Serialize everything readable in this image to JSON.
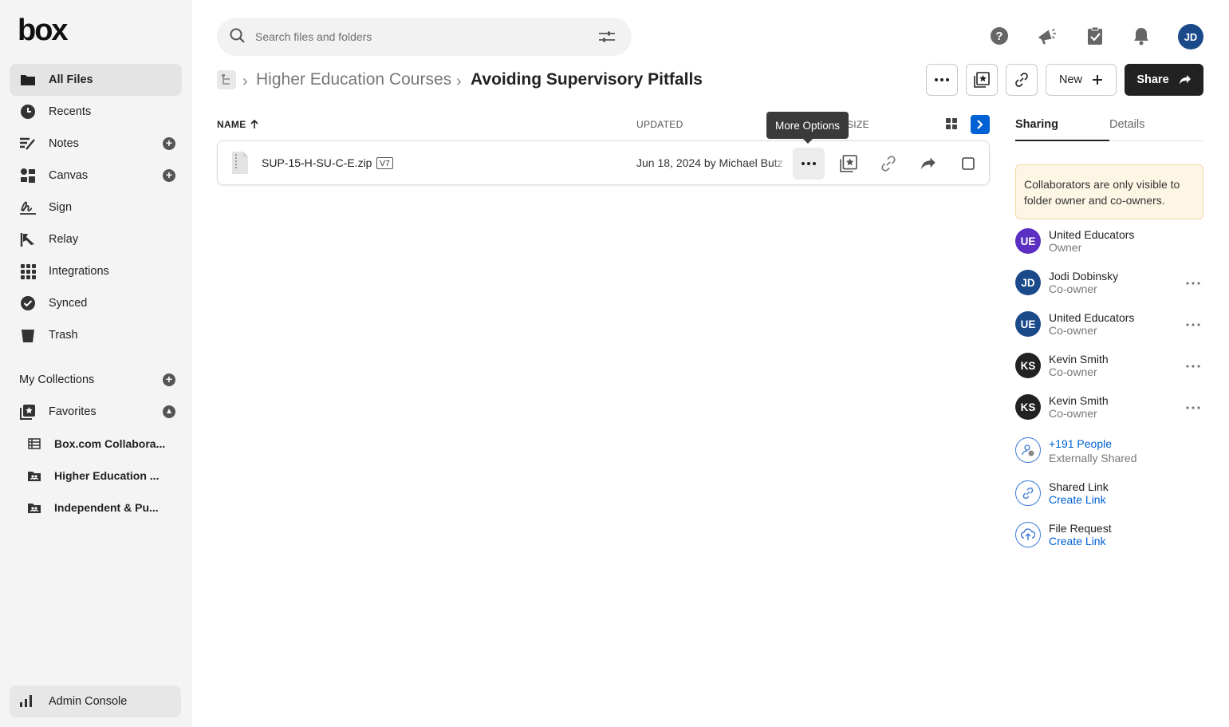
{
  "app": {
    "logo_text": "box"
  },
  "sidebar": {
    "items": [
      {
        "label": "All Files",
        "icon": "folder-icon"
      },
      {
        "label": "Recents",
        "icon": "clock-icon"
      },
      {
        "label": "Notes",
        "icon": "notes-icon"
      },
      {
        "label": "Canvas",
        "icon": "canvas-icon"
      },
      {
        "label": "Sign",
        "icon": "sign-icon"
      },
      {
        "label": "Relay",
        "icon": "relay-icon"
      },
      {
        "label": "Integrations",
        "icon": "grid-icon"
      },
      {
        "label": "Synced",
        "icon": "check-circle-icon"
      },
      {
        "label": "Trash",
        "icon": "trash-icon"
      }
    ],
    "collections_label": "My Collections",
    "favorites_label": "Favorites",
    "favorites": [
      {
        "label": "Box.com Collaboration Site",
        "display": "Box.com Collabora..."
      },
      {
        "label": "Higher Education Courses",
        "display": "Higher Education ..."
      },
      {
        "label": "Independent & Public Schools",
        "display": "Independent & Pu..."
      }
    ],
    "admin_label": "Admin Console"
  },
  "header": {
    "search_placeholder": "Search files and folders",
    "user_initials": "JD"
  },
  "breadcrumb": {
    "parent": "Higher Education Courses",
    "current": "Avoiding Supervisory Pitfalls"
  },
  "toolbar": {
    "new_label": "New",
    "share_label": "Share"
  },
  "list": {
    "col_name": "NAME",
    "col_updated": "UPDATED",
    "col_size": "SIZE",
    "tooltip": "More Options",
    "files": [
      {
        "name": "SUP-15-H-SU-C-E.zip",
        "version": "V7",
        "updated": "Jun 18, 2024 by Michael Butz"
      }
    ]
  },
  "panel": {
    "tab_sharing": "Sharing",
    "tab_details": "Details",
    "notice": "Collaborators are only visible to folder owner and co-owners.",
    "collaborators": [
      {
        "initials": "UE",
        "name": "United Educators",
        "role": "Owner",
        "color": "#5a2fc2"
      },
      {
        "initials": "JD",
        "name": "Jodi Dobinsky",
        "role": "Co-owner",
        "color": "#1a4a8a"
      },
      {
        "initials": "UE",
        "name": "United Educators",
        "role": "Co-owner",
        "color": "#1a4a8a"
      },
      {
        "initials": "KS",
        "name": "Kevin Smith",
        "role": "Co-owner",
        "color": "#222222"
      },
      {
        "initials": "KS",
        "name": "Kevin Smith",
        "role": "Co-owner",
        "color": "#222222"
      }
    ],
    "people_more": "+191 People",
    "people_sub": "Externally Shared",
    "shared_link_label": "Shared Link",
    "shared_link_action": "Create Link",
    "file_request_label": "File Request",
    "file_request_action": "Create Link"
  },
  "colors": {
    "accent": "#0061d5",
    "share_btn": "#222222",
    "notice_bg": "#fdf6e4"
  }
}
